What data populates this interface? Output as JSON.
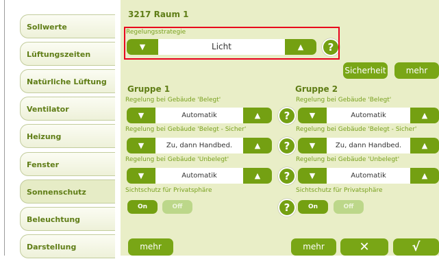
{
  "tabs": [
    {
      "label": "Sollwerte"
    },
    {
      "label": "Lüftungszeiten"
    },
    {
      "label": "Natürliche Lüftung"
    },
    {
      "label": "Ventilator"
    },
    {
      "label": "Heizung"
    },
    {
      "label": "Fenster"
    },
    {
      "label": "Sonnenschutz"
    },
    {
      "label": "Beleuchtung"
    },
    {
      "label": "Darstellung"
    }
  ],
  "active_tab": "Sonnenschutz",
  "room_title": "3217 Raum 1",
  "strategy": {
    "label": "Regelungsstrategie",
    "value": "Licht",
    "help": "?"
  },
  "buttons": {
    "sicherheit": "Sicherheit",
    "mehr_top": "mehr",
    "mehr_bottom_left": "mehr",
    "mehr_bottom_right": "mehr",
    "cancel": "✕",
    "confirm": "√"
  },
  "groups": [
    {
      "title": "Gruppe 1",
      "rows": [
        {
          "label": "Regelung bei Gebäude 'Belegt'",
          "value": "Automatik"
        },
        {
          "label": "Regelung bei Gebäude 'Belegt - Sicher'",
          "value": "Zu, dann Handbed."
        },
        {
          "label": "Regelung bei Gebäude 'Unbelegt'",
          "value": "Automatik"
        }
      ],
      "privacy_label": "Sichtschutz für Privatsphäre",
      "on": "On",
      "off": "Off"
    },
    {
      "title": "Gruppe 2",
      "rows": [
        {
          "label": "Regelung bei Gebäude 'Belegt'",
          "value": "Automatik"
        },
        {
          "label": "Regelung bei Gebäude 'Belegt - Sicher'",
          "value": "Zu, dann Handbed."
        },
        {
          "label": "Regelung bei Gebäude 'Unbelegt'",
          "value": "Automatik"
        }
      ],
      "privacy_label": "Sichtschutz für Privatsphäre",
      "on": "On",
      "off": "Off"
    }
  ],
  "help_symbol": "?",
  "arrow_down": "▼",
  "arrow_up": "▲",
  "colors": {
    "accent": "#74a012",
    "panel": "#e9eec7",
    "highlight": "#e8001c"
  }
}
